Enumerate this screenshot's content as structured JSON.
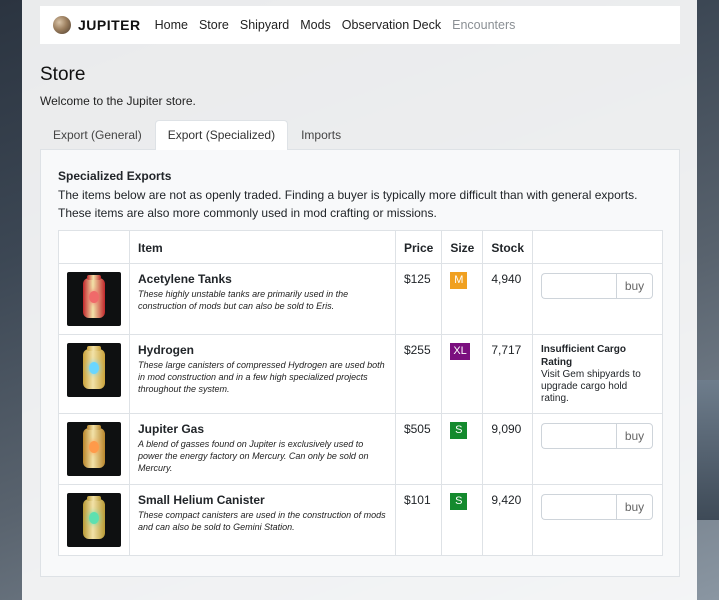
{
  "app": {
    "brand": "JUPITER"
  },
  "nav": [
    {
      "label": "Home",
      "disabled": false
    },
    {
      "label": "Store",
      "disabled": false
    },
    {
      "label": "Shipyard",
      "disabled": false
    },
    {
      "label": "Mods",
      "disabled": false
    },
    {
      "label": "Observation Deck",
      "disabled": false
    },
    {
      "label": "Encounters",
      "disabled": true
    }
  ],
  "page": {
    "title": "Store",
    "subtitle": "Welcome to the Jupiter store."
  },
  "tabs": [
    {
      "label": "Export (General)",
      "active": false
    },
    {
      "label": "Export (Specialized)",
      "active": true
    },
    {
      "label": "Imports",
      "active": false
    }
  ],
  "section": {
    "title": "Specialized Exports",
    "description": "The items below are not as openly traded. Finding a buyer is typically more difficult than with general exports. These items are also more commonly used in mod crafting or missions."
  },
  "table": {
    "headers": {
      "image": "",
      "item": "Item",
      "price": "Price",
      "size": "Size",
      "stock": "Stock",
      "action": ""
    },
    "buy_label": "buy",
    "rows": [
      {
        "name": "Acetylene Tanks",
        "description": "These highly unstable tanks are primarily used in the construction of mods but can also be sold to Eris.",
        "price": "$125",
        "size": "M",
        "size_color": "#f0a020",
        "stock": "4,940",
        "icon": "red-canister-icon",
        "canister_color": "#c0262b",
        "glow_color": "#f06a6a",
        "action": "buy",
        "qty": ""
      },
      {
        "name": "Hydrogen",
        "description": "These large canisters of compressed Hydrogen are used both in mod construction and in a few high specialized projects throughout the system.",
        "price": "$255",
        "size": "XL",
        "size_color": "#7b0f7f",
        "stock": "7,717",
        "icon": "yellow-canister-icon",
        "canister_color": "#c9a23a",
        "glow_color": "#6ad6ff",
        "action": "warning",
        "warning_title": "Insufficient Cargo Rating",
        "warning_text": "Visit Gem shipyards to upgrade cargo hold rating."
      },
      {
        "name": "Jupiter Gas",
        "description": "A blend of gasses found on Jupiter is exclusively used to power the energy factory on Mercury. Can only be sold on Mercury.",
        "price": "$505",
        "size": "S",
        "size_color": "#148a2e",
        "stock": "9,090",
        "icon": "gold-canister-icon",
        "canister_color": "#b8862c",
        "glow_color": "#ff9a4a",
        "action": "buy",
        "qty": ""
      },
      {
        "name": "Small Helium Canister",
        "description": "These compact canisters are used in the construction of mods and can also be sold to Gemini Station.",
        "price": "$101",
        "size": "S",
        "size_color": "#148a2e",
        "stock": "9,420",
        "icon": "green-canister-icon",
        "canister_color": "#b89a35",
        "glow_color": "#5ee0b0",
        "action": "buy",
        "qty": ""
      }
    ]
  }
}
